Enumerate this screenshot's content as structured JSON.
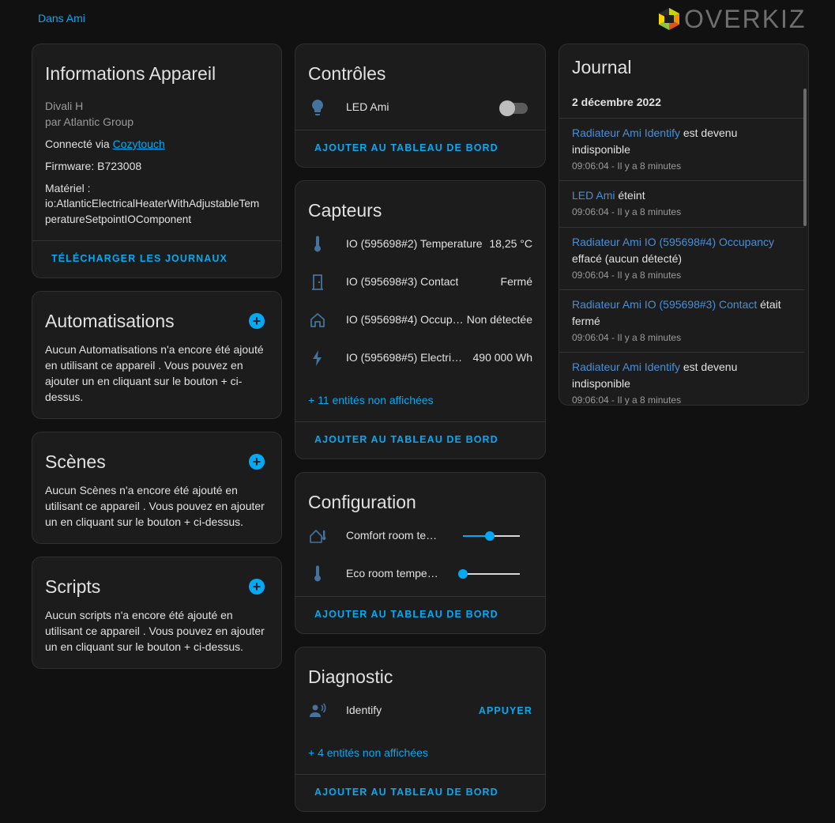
{
  "header": {
    "area_link": "Dans Ami",
    "logo_text": "OVERKIZ"
  },
  "device_info": {
    "title": "Informations Appareil",
    "model": "Divali H",
    "manufacturer": "par Atlantic Group",
    "connected_prefix": "Connecté via ",
    "connected_link": "Cozytouch",
    "firmware": "Firmware: B723008",
    "hardware_label": "Matériel :",
    "hardware_line1": "io:AtlanticElectricalHeaterWithAdjustableTem",
    "hardware_line2": "peratureSetpointIOComponent",
    "download_button": "TÉLÉCHARGER LES JOURNAUX"
  },
  "automations": {
    "title": "Automatisations",
    "empty_lines": [
      "Aucun Automatisations n'a encore été ajouté",
      "en utilisant ce appareil . Vous pouvez en",
      "ajouter un en cliquant sur le bouton + ci-",
      "dessus."
    ]
  },
  "scenes": {
    "title": "Scènes",
    "empty_lines": [
      "Aucun Scènes n'a encore été ajouté en",
      "utilisant ce appareil . Vous pouvez en ajouter",
      "un en cliquant sur le bouton + ci-dessus."
    ]
  },
  "scripts": {
    "title": "Scripts",
    "empty_lines": [
      "Aucun scripts n'a encore été ajouté en",
      "utilisant ce appareil . Vous pouvez en ajouter",
      "un en cliquant sur le bouton + ci-dessus."
    ]
  },
  "controls": {
    "title": "Contrôles",
    "led_name": "LED Ami",
    "led_icon": "lightbulb-icon",
    "led_state": "off",
    "add_button": "AJOUTER AU TABLEAU DE BORD"
  },
  "sensors": {
    "title": "Capteurs",
    "rows": [
      {
        "icon": "thermometer-icon",
        "name": "IO (595698#2) Temperature",
        "value": "18,25 °C"
      },
      {
        "icon": "door-icon",
        "name": "IO (595698#3) Contact",
        "value": "Fermé"
      },
      {
        "icon": "home-icon",
        "name": "IO (595698#4) Occup…",
        "value": "Non détectée"
      },
      {
        "icon": "lightning-icon",
        "name": "IO (595698#5) Electric …",
        "value": "490 000 Wh"
      }
    ],
    "more": "+ 11 entités non affichées",
    "add_button": "AJOUTER AU TABLEAU DE BORD"
  },
  "configuration": {
    "title": "Configuration",
    "rows": [
      {
        "icon": "home-thermometer-icon",
        "name": "Comfort room te…",
        "fraction": 0.47
      },
      {
        "icon": "thermometer-icon",
        "name": "Eco room temper…",
        "fraction": 0.0
      }
    ],
    "add_button": "AJOUTER AU TABLEAU DE BORD"
  },
  "diagnostic": {
    "title": "Diagnostic",
    "row_icon": "account-voice-icon",
    "row_name": "Identify",
    "row_button": "APPUYER",
    "more": "+ 4 entités non affichées",
    "add_button": "AJOUTER AU TABLEAU DE BORD"
  },
  "journal": {
    "title": "Journal",
    "date": "2 décembre 2022",
    "entries": [
      {
        "entity": "Radiateur Ami Identify",
        "action": " est devenu indisponible",
        "time": "09:06:04 - Il y a 8 minutes"
      },
      {
        "entity": "LED Ami",
        "action": " éteint",
        "time": "09:06:04 - Il y a 8 minutes"
      },
      {
        "entity": "Radiateur Ami IO (595698#4) Occupancy",
        "action": " effacé (aucun détecté)",
        "time": "09:06:04 - Il y a 8 minutes"
      },
      {
        "entity": "Radiateur Ami IO (595698#3) Contact",
        "action": " était fermé",
        "time": "09:06:04 - Il y a 8 minutes"
      },
      {
        "entity": "Radiateur Ami Identify",
        "action": " est devenu indisponible",
        "time": "09:06:04 - Il y a 8 minutes"
      }
    ]
  },
  "colors": {
    "accent": "#03a9f4",
    "background": "#111111",
    "card": "#1c1c1c",
    "entity_link": "#4a8fd6"
  }
}
